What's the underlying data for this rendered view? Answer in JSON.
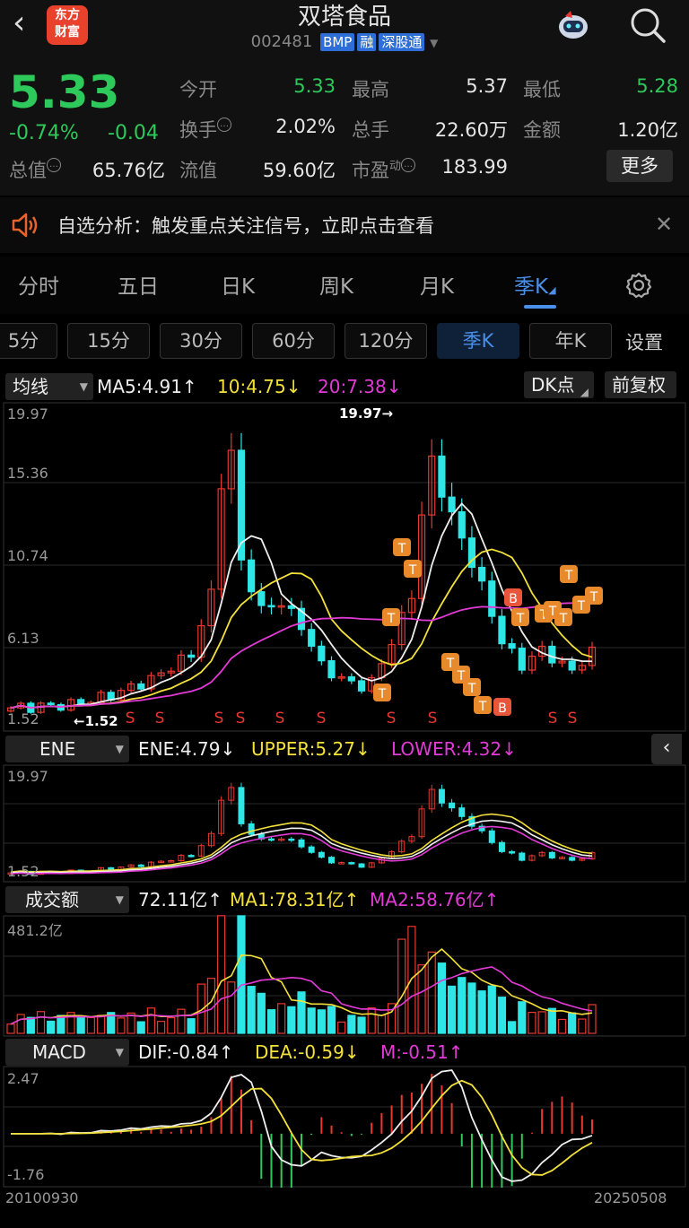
{
  "header": {
    "logo_line1": "东方",
    "logo_line2": "财富",
    "title": "双塔食品",
    "code": "002481",
    "tags": [
      "BMP",
      "融",
      "深股通"
    ]
  },
  "quote": {
    "price": "5.33",
    "change_pct": "-0.74%",
    "change": "-0.04",
    "rows": [
      [
        {
          "label": "今开",
          "value": "5.33",
          "color": "green"
        },
        {
          "label": "最高",
          "value": "5.37",
          "color": "white"
        },
        {
          "label": "最低",
          "value": "5.28",
          "color": "green"
        }
      ],
      [
        {
          "label": "换手",
          "value": "2.02%",
          "color": "white"
        },
        {
          "label": "总手",
          "value": "22.60万",
          "color": "white"
        },
        {
          "label": "金额",
          "value": "1.20亿",
          "color": "white"
        }
      ],
      [
        {
          "label": "总值",
          "value": "65.76亿",
          "color": "white"
        },
        {
          "label": "流值",
          "value": "59.60亿",
          "color": "white"
        },
        {
          "label": "市盈",
          "value": "183.99",
          "color": "white"
        }
      ]
    ],
    "pe_sup": "动",
    "more_label": "更多"
  },
  "notice": {
    "text": "自选分析：触发重点关注信号，立即点击查看"
  },
  "tabs": [
    "分时",
    "五日",
    "日K",
    "周K",
    "月K",
    "季K"
  ],
  "sub_tabs": [
    "5分",
    "15分",
    "30分",
    "60分",
    "120分",
    "季K",
    "年K"
  ],
  "sub_settings": "设置",
  "main_indicator": {
    "name": "均线",
    "ma5": "MA5:4.91↑",
    "ma10": "10:4.75↓",
    "ma20": "20:7.38↓",
    "dk": "DK点",
    "adjust": "前复权",
    "y_labels": [
      "19.97",
      "15.36",
      "10.74",
      "6.13",
      "1.52"
    ],
    "high_label": "19.97→",
    "low_label": "←1.52"
  },
  "ene": {
    "name": "ENE",
    "ene": "ENE:4.79↓",
    "upper": "UPPER:5.27↓",
    "lower": "LOWER:4.32↓",
    "y_labels": [
      "19.97",
      "1.52"
    ]
  },
  "volume": {
    "name": "成交额",
    "vol": "72.11亿↑",
    "ma1": "MA1:78.31亿↑",
    "ma2": "MA2:58.76亿↑",
    "y_label": "481.2亿"
  },
  "macd": {
    "name": "MACD",
    "dif": "DIF:-0.84↑",
    "dea": "DEA:-0.59↓",
    "m": "M:-0.51↑",
    "y_labels": [
      "2.47",
      "-1.76"
    ]
  },
  "dates": {
    "start": "20100930",
    "end": "20250508"
  },
  "colors": {
    "up": "#e8382f",
    "down": "#2ee6e6",
    "accent": "#4a8fe8",
    "green": "#2ec95b"
  }
}
